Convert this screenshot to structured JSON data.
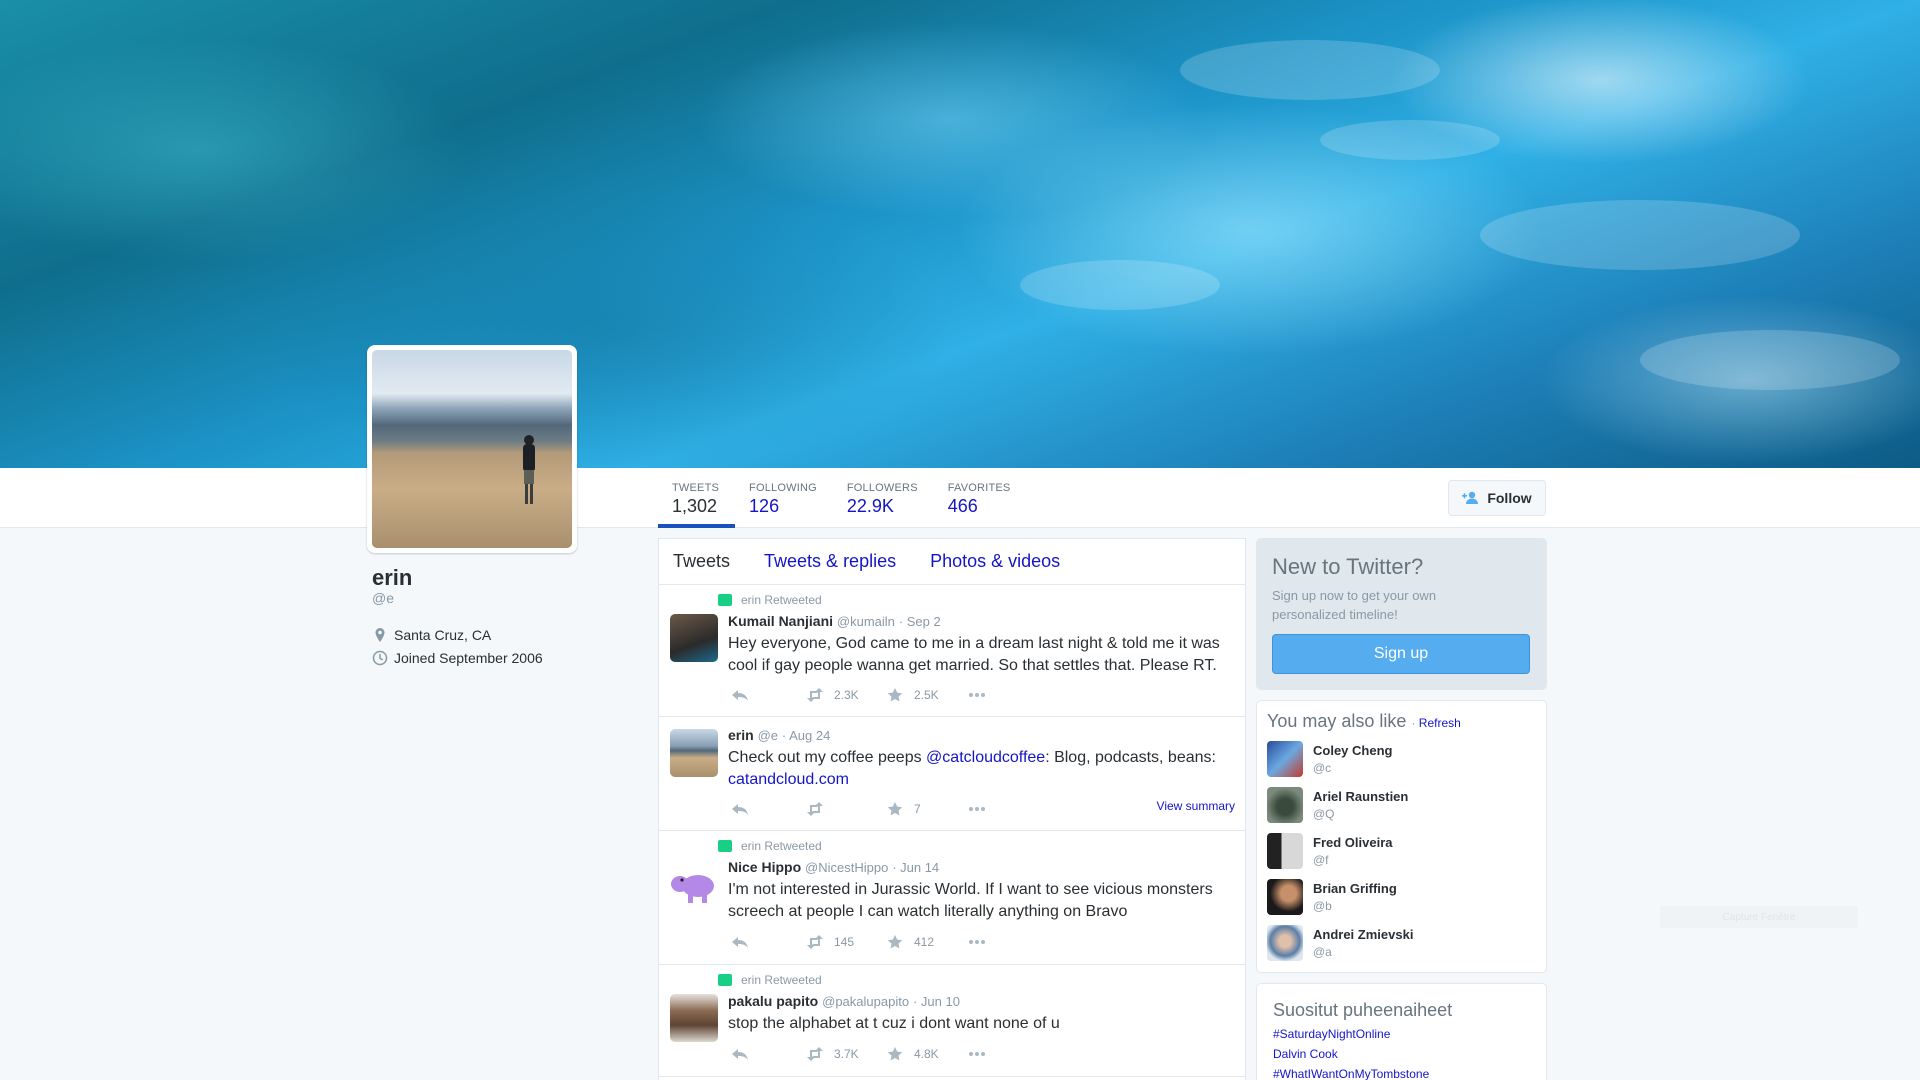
{
  "profile": {
    "name": "erin",
    "handle": "@e",
    "location": "Santa Cruz, CA",
    "joined": "Joined September 2006"
  },
  "stats": [
    {
      "label": "TWEETS",
      "value": "1,302"
    },
    {
      "label": "FOLLOWING",
      "value": "126"
    },
    {
      "label": "FOLLOWERS",
      "value": "22.9K"
    },
    {
      "label": "FAVORITES",
      "value": "466"
    }
  ],
  "follow_label": "Follow",
  "timeline": {
    "tabs": [
      "Tweets",
      "Tweets & replies",
      "Photos & videos"
    ],
    "tweets": [
      {
        "retweet_label": "erin Retweeted",
        "name": "Kumail Nanjiani",
        "handle": "@kumailn",
        "date": "· Sep 2",
        "text": "Hey everyone, God came to me in a dream last night & told me it was cool if gay people wanna get married. So that settles that. Please RT.",
        "retweets": "2.3K",
        "favorites": "2.5K"
      },
      {
        "name": "erin",
        "handle": "@e",
        "date": "· Aug 24",
        "text_prefix": "Check out my coffee peeps ",
        "mention": "@catcloudcoffee",
        "text_suffix": ":  Blog, podcasts, beans:",
        "link": "catandcloud.com",
        "favorites": "7",
        "view_summary": "View summary"
      },
      {
        "retweet_label": "erin Retweeted",
        "name": "Nice Hippo",
        "handle": "@NicestHippo",
        "date": "· Jun 14",
        "text": "I'm not interested in Jurassic World. If I want to see vicious monsters screech at people I can watch literally anything on Bravo",
        "retweets": "145",
        "favorites": "412"
      },
      {
        "retweet_label": "erin Retweeted",
        "name": "pakalu papito",
        "handle": "@pakalupapito",
        "date": "· Jun 10",
        "text": "stop the alphabet at t cuz i dont want none of u",
        "retweets": "3.7K",
        "favorites": "4.8K"
      }
    ]
  },
  "signup": {
    "title": "New to Twitter?",
    "subtitle": "Sign up now to get your own personalized timeline!",
    "button": "Sign up"
  },
  "who_to_follow": {
    "title": "You may also like",
    "refresh": "Refresh",
    "users": [
      {
        "name": "Coley Cheng",
        "handle": "@c"
      },
      {
        "name": "Ariel Raunstien",
        "handle": "@Q"
      },
      {
        "name": "Fred Oliveira",
        "handle": "@f"
      },
      {
        "name": "Brian Griffing",
        "handle": "@b"
      },
      {
        "name": "Andrei Zmievski",
        "handle": "@a"
      }
    ]
  },
  "trends": {
    "title": "Suositut puheenaiheet",
    "items": [
      "#SaturdayNightOnline",
      "Dalvin Cook",
      "#WhatIWantOnMyTombstone"
    ]
  },
  "ghost_label": "Capture Fenêtre",
  "colors": {
    "link": "#1515c8",
    "active_tab": "#1b51bd",
    "retweet": "#19cf86",
    "signup_button": "#55acee"
  }
}
